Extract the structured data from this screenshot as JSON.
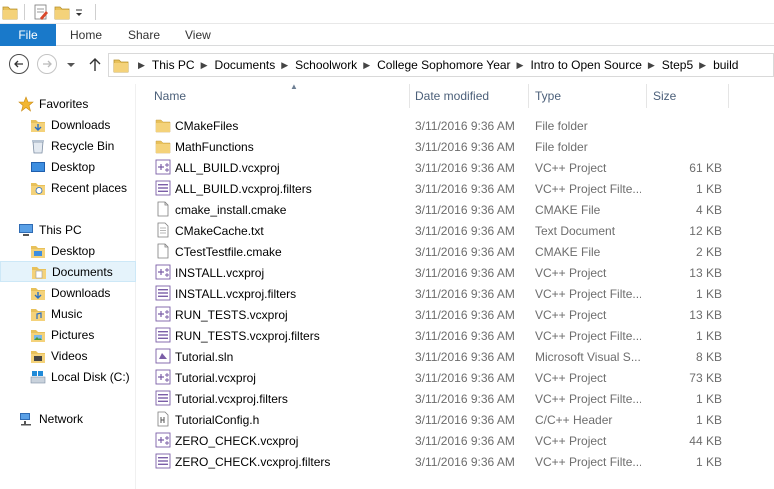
{
  "ribbon": {
    "file_tab": "File",
    "tabs": [
      "Home",
      "Share",
      "View"
    ]
  },
  "address": {
    "crumbs": [
      "This PC",
      "Documents",
      "Schoolwork",
      "College Sophomore Year",
      "Intro to Open Source",
      "Step5",
      "build"
    ]
  },
  "navpane": {
    "favorites": {
      "label": "Favorites",
      "items": [
        "Downloads",
        "Recycle Bin",
        "Desktop",
        "Recent places"
      ]
    },
    "thispc": {
      "label": "This PC",
      "items": [
        "Desktop",
        "Documents",
        "Downloads",
        "Music",
        "Pictures",
        "Videos",
        "Local Disk (C:)"
      ]
    },
    "network": {
      "label": "Network"
    },
    "selected": "Documents"
  },
  "columns": {
    "name": "Name",
    "date": "Date modified",
    "type": "Type",
    "size": "Size"
  },
  "files": [
    {
      "name": "CMakeFiles",
      "date": "3/11/2016 9:36 AM",
      "type": "File folder",
      "size": "",
      "icon": "folder-icon"
    },
    {
      "name": "MathFunctions",
      "date": "3/11/2016 9:36 AM",
      "type": "File folder",
      "size": "",
      "icon": "folder-icon"
    },
    {
      "name": "ALL_BUILD.vcxproj",
      "date": "3/11/2016 9:36 AM",
      "type": "VC++ Project",
      "size": "61 KB",
      "icon": "vcxproj-icon"
    },
    {
      "name": "ALL_BUILD.vcxproj.filters",
      "date": "3/11/2016 9:36 AM",
      "type": "VC++ Project Filte...",
      "size": "1 KB",
      "icon": "filters-icon"
    },
    {
      "name": "cmake_install.cmake",
      "date": "3/11/2016 9:36 AM",
      "type": "CMAKE File",
      "size": "4 KB",
      "icon": "file-icon"
    },
    {
      "name": "CMakeCache.txt",
      "date": "3/11/2016 9:36 AM",
      "type": "Text Document",
      "size": "12 KB",
      "icon": "text-file-icon"
    },
    {
      "name": "CTestTestfile.cmake",
      "date": "3/11/2016 9:36 AM",
      "type": "CMAKE File",
      "size": "2 KB",
      "icon": "file-icon"
    },
    {
      "name": "INSTALL.vcxproj",
      "date": "3/11/2016 9:36 AM",
      "type": "VC++ Project",
      "size": "13 KB",
      "icon": "vcxproj-icon"
    },
    {
      "name": "INSTALL.vcxproj.filters",
      "date": "3/11/2016 9:36 AM",
      "type": "VC++ Project Filte...",
      "size": "1 KB",
      "icon": "filters-icon"
    },
    {
      "name": "RUN_TESTS.vcxproj",
      "date": "3/11/2016 9:36 AM",
      "type": "VC++ Project",
      "size": "13 KB",
      "icon": "vcxproj-icon"
    },
    {
      "name": "RUN_TESTS.vcxproj.filters",
      "date": "3/11/2016 9:36 AM",
      "type": "VC++ Project Filte...",
      "size": "1 KB",
      "icon": "filters-icon"
    },
    {
      "name": "Tutorial.sln",
      "date": "3/11/2016 9:36 AM",
      "type": "Microsoft Visual S...",
      "size": "8 KB",
      "icon": "solution-icon"
    },
    {
      "name": "Tutorial.vcxproj",
      "date": "3/11/2016 9:36 AM",
      "type": "VC++ Project",
      "size": "73 KB",
      "icon": "vcxproj-icon"
    },
    {
      "name": "Tutorial.vcxproj.filters",
      "date": "3/11/2016 9:36 AM",
      "type": "VC++ Project Filte...",
      "size": "1 KB",
      "icon": "filters-icon"
    },
    {
      "name": "TutorialConfig.h",
      "date": "3/11/2016 9:36 AM",
      "type": "C/C++ Header",
      "size": "1 KB",
      "icon": "header-file-icon"
    },
    {
      "name": "ZERO_CHECK.vcxproj",
      "date": "3/11/2016 9:36 AM",
      "type": "VC++ Project",
      "size": "44 KB",
      "icon": "vcxproj-icon"
    },
    {
      "name": "ZERO_CHECK.vcxproj.filters",
      "date": "3/11/2016 9:36 AM",
      "type": "VC++ Project Filte...",
      "size": "1 KB",
      "icon": "filters-icon"
    }
  ],
  "colors": {
    "accent": "#1979ca",
    "folder": "#e8c15a",
    "selected_bg": "#e5f3fb",
    "header_text": "#4c607a"
  }
}
